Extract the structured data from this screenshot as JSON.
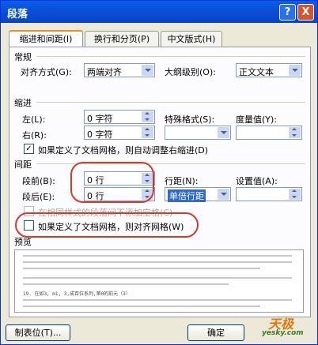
{
  "window": {
    "title": "段落",
    "help_button": "?",
    "close_button": "X"
  },
  "tabs": [
    "缩进和间距(I)",
    "换行和分页(P)",
    "中文版式(H)"
  ],
  "general": {
    "section": "常规",
    "alignment_label": "对齐方式(G):",
    "alignment_value": "两端对齐",
    "outline_label": "大纲级别(O):",
    "outline_value": "正文文本"
  },
  "indent": {
    "section": "缩进",
    "left_label": "左(L):",
    "left_value": "0 字符",
    "right_label": "右(R):",
    "right_value": "0 字符",
    "special_label": "特殊格式(S):",
    "special_value": "",
    "by_label": "度量值(Y):",
    "by_value": "",
    "auto_adjust_label": "如果定义了文档网格，则自动调整右缩进(D)",
    "auto_adjust_checked": true
  },
  "spacing": {
    "section": "间距",
    "before_label": "段前(B):",
    "before_value": "0 行",
    "after_label": "段后(E):",
    "after_value": "0 行",
    "line_label": "行距(N):",
    "line_value": "单倍行距",
    "at_label": "设置值(A):",
    "at_value": "",
    "no_space_label": "在相同样式的段落间不添加空格(C)",
    "no_space_checked": false,
    "snap_grid_label": "如果定义了文档网格，则对齐网格(W)",
    "snap_grid_checked": false
  },
  "preview": {
    "section": "预览",
    "sample": "19. 在如3,  m1,  3,成百位系列,第0的前元（3）"
  },
  "footer": {
    "tabs_button": "制表位(T)...",
    "ok_button": "确定"
  },
  "watermark": {
    "brand": "天极",
    "url": "yesky.com"
  },
  "colors": {
    "annotation": "#d83a2a",
    "titlebar": "#0a5fe8"
  }
}
